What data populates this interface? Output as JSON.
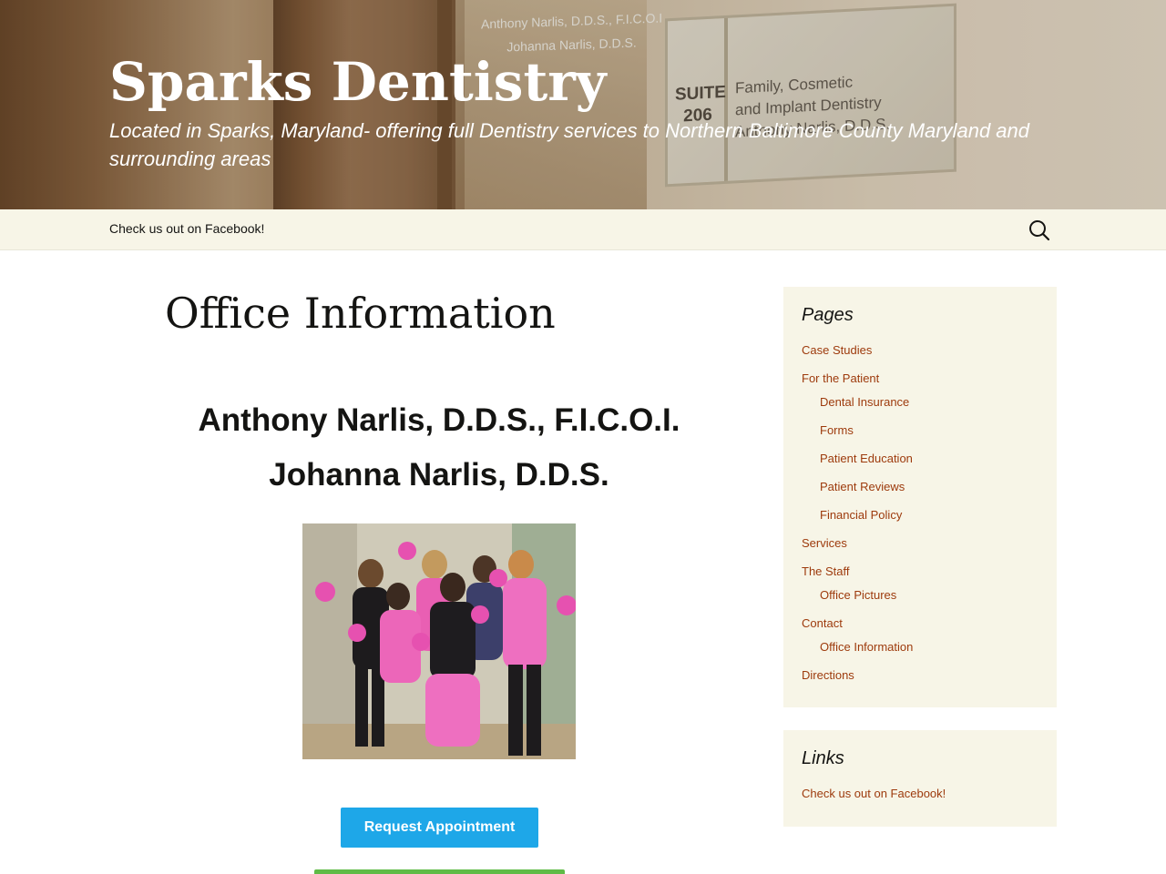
{
  "header": {
    "title": "Sparks Dentistry",
    "description": "Located in Sparks, Maryland- offering full Dentistry services to Northern Baltimore County Maryland and surrounding areas",
    "photo": {
      "door_names": [
        "Anthony Narlis, D.D.S., F.I.C.O.I",
        "Johanna Narlis, D.D.S."
      ],
      "suite": [
        "SUITE",
        "206"
      ],
      "plaque_lines": [
        "Family, Cosmetic",
        "and Implant Dentistry",
        "Anthony Narlis, D.D.S."
      ]
    }
  },
  "nav": {
    "facebook_link": "Check us out on Facebook!",
    "search_icon": "search-icon"
  },
  "main": {
    "title": "Office Information",
    "doctor_1": "Anthony Narlis, D.D.S., F.I.C.O.I.",
    "doctor_2": "Johanna Narlis, D.D.S.",
    "photo_icon": "staff-photo",
    "appointment_button": "Request Appointment"
  },
  "sidebar": {
    "pages_title": "Pages",
    "pages": [
      {
        "label": "Case Studies",
        "level": 1
      },
      {
        "label": "For the Patient",
        "level": 1
      },
      {
        "label": "Dental Insurance",
        "level": 2
      },
      {
        "label": "Forms",
        "level": 2
      },
      {
        "label": "Patient Education",
        "level": 2
      },
      {
        "label": "Patient Reviews",
        "level": 2
      },
      {
        "label": "Financial Policy",
        "level": 2
      },
      {
        "label": "Services",
        "level": 1
      },
      {
        "label": "The Staff",
        "level": 1
      },
      {
        "label": "Office Pictures",
        "level": 2
      },
      {
        "label": "Contact",
        "level": 1
      },
      {
        "label": "Office Information",
        "level": 2
      },
      {
        "label": "Directions",
        "level": 1
      }
    ],
    "links_title": "Links",
    "links": [
      {
        "label": "Check us out on Facebook!"
      }
    ]
  },
  "colors": {
    "nav_bg": "#f7f5e7",
    "link": "#9d3a0c",
    "button_blue": "#1ea7e8",
    "button_green": "#5fbb46"
  }
}
